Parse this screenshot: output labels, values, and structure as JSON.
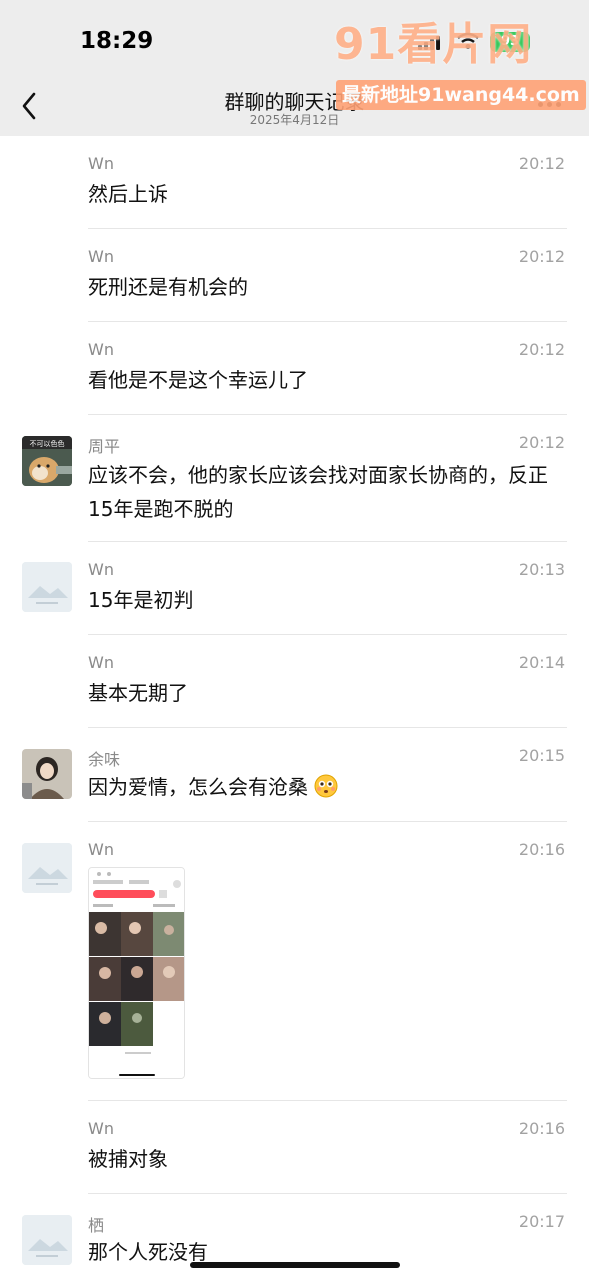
{
  "status_bar": {
    "time": "18:29",
    "battery": "93"
  },
  "header": {
    "title": "群聊的聊天记录",
    "subtitle": "2025年4月12日"
  },
  "watermark": {
    "logo": "91看片网",
    "url": "最新地址91wang44.com"
  },
  "messages": [
    {
      "sender": "Wn",
      "time": "20:12",
      "text": "然后上诉"
    },
    {
      "sender": "Wn",
      "time": "20:12",
      "text": "死刑还是有机会的"
    },
    {
      "sender": "Wn",
      "time": "20:12",
      "text": "看他是不是这个幸运儿了"
    },
    {
      "sender": "周平",
      "time": "20:12",
      "text": "应该不会，他的家长应该会找对面家长协商的，反正15年是跑不脱的",
      "avatar_caption": "不可以色色"
    },
    {
      "sender": "Wn",
      "time": "20:13",
      "text": "15年是初判"
    },
    {
      "sender": "Wn",
      "time": "20:14",
      "text": "基本无期了"
    },
    {
      "sender": "余味",
      "time": "20:15",
      "text": "因为爱情，怎么会有沧桑"
    },
    {
      "sender": "Wn",
      "time": "20:16",
      "text": ""
    },
    {
      "sender": "Wn",
      "time": "20:16",
      "text": "被捕对象"
    },
    {
      "sender": "栖",
      "time": "20:17",
      "text": "那个人死没有"
    }
  ],
  "icons": {
    "back": "chevron-left-icon",
    "more": "more-dots-icon",
    "emoji": "flushed-face-emoji-icon"
  },
  "colors": {
    "header_bg": "#ededed",
    "battery": "#35c759",
    "watermark": "#ffa276"
  }
}
